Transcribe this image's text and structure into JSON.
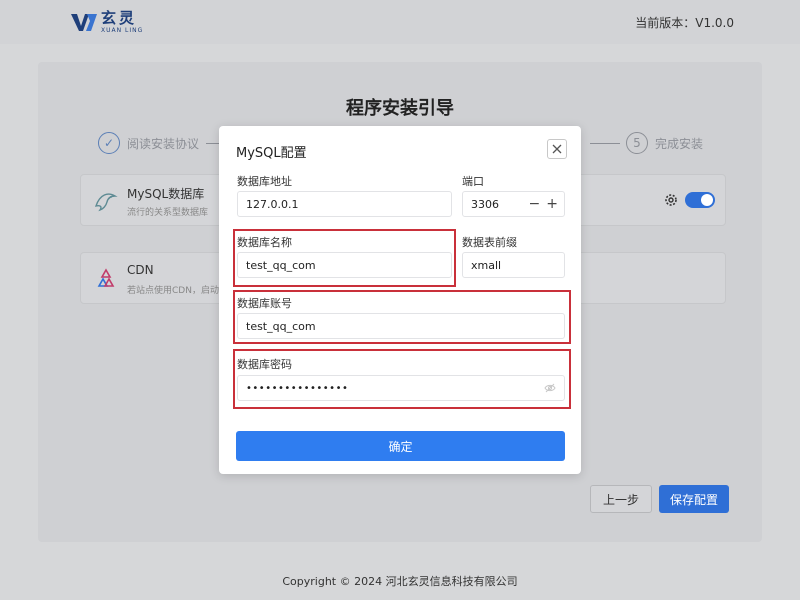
{
  "header": {
    "logo_cn": "玄灵",
    "logo_en": "XUAN LING",
    "version": "当前版本：V1.0.0"
  },
  "page": {
    "title": "程序安装引导",
    "steps": [
      {
        "label": "阅读安装协议",
        "marker": "✓"
      },
      {
        "label": "完成安装",
        "marker": "5"
      }
    ],
    "services": [
      {
        "name": "MySQL数据库",
        "desc": "流行的关系型数据库",
        "icon": "dolphin-icon",
        "enabled": true
      },
      {
        "name": "CDN",
        "desc": "若站点使用CDN，启动",
        "icon": "cdn-icon"
      }
    ],
    "prev_label": "上一步",
    "save_label": "保存配置"
  },
  "modal": {
    "title": "MySQL配置",
    "fields": {
      "host": {
        "label": "数据库地址",
        "value": "127.0.0.1"
      },
      "port": {
        "label": "端口",
        "value": "3306"
      },
      "db_name": {
        "label": "数据库名称",
        "value": "test_qq_com"
      },
      "prefix": {
        "label": "数据表前缀",
        "value": "xmall"
      },
      "account": {
        "label": "数据库账号",
        "value": "test_qq_com"
      },
      "password": {
        "label": "数据库密码",
        "value": "••••••••••••••••"
      }
    },
    "stepper_minus": "−",
    "stepper_plus": "+",
    "confirm_label": "确定"
  },
  "footer": {
    "copyright": "Copyright © 2024 河北玄灵信息科技有限公司"
  },
  "colors": {
    "primary": "#2f7df0",
    "highlight": "#c9303a"
  }
}
